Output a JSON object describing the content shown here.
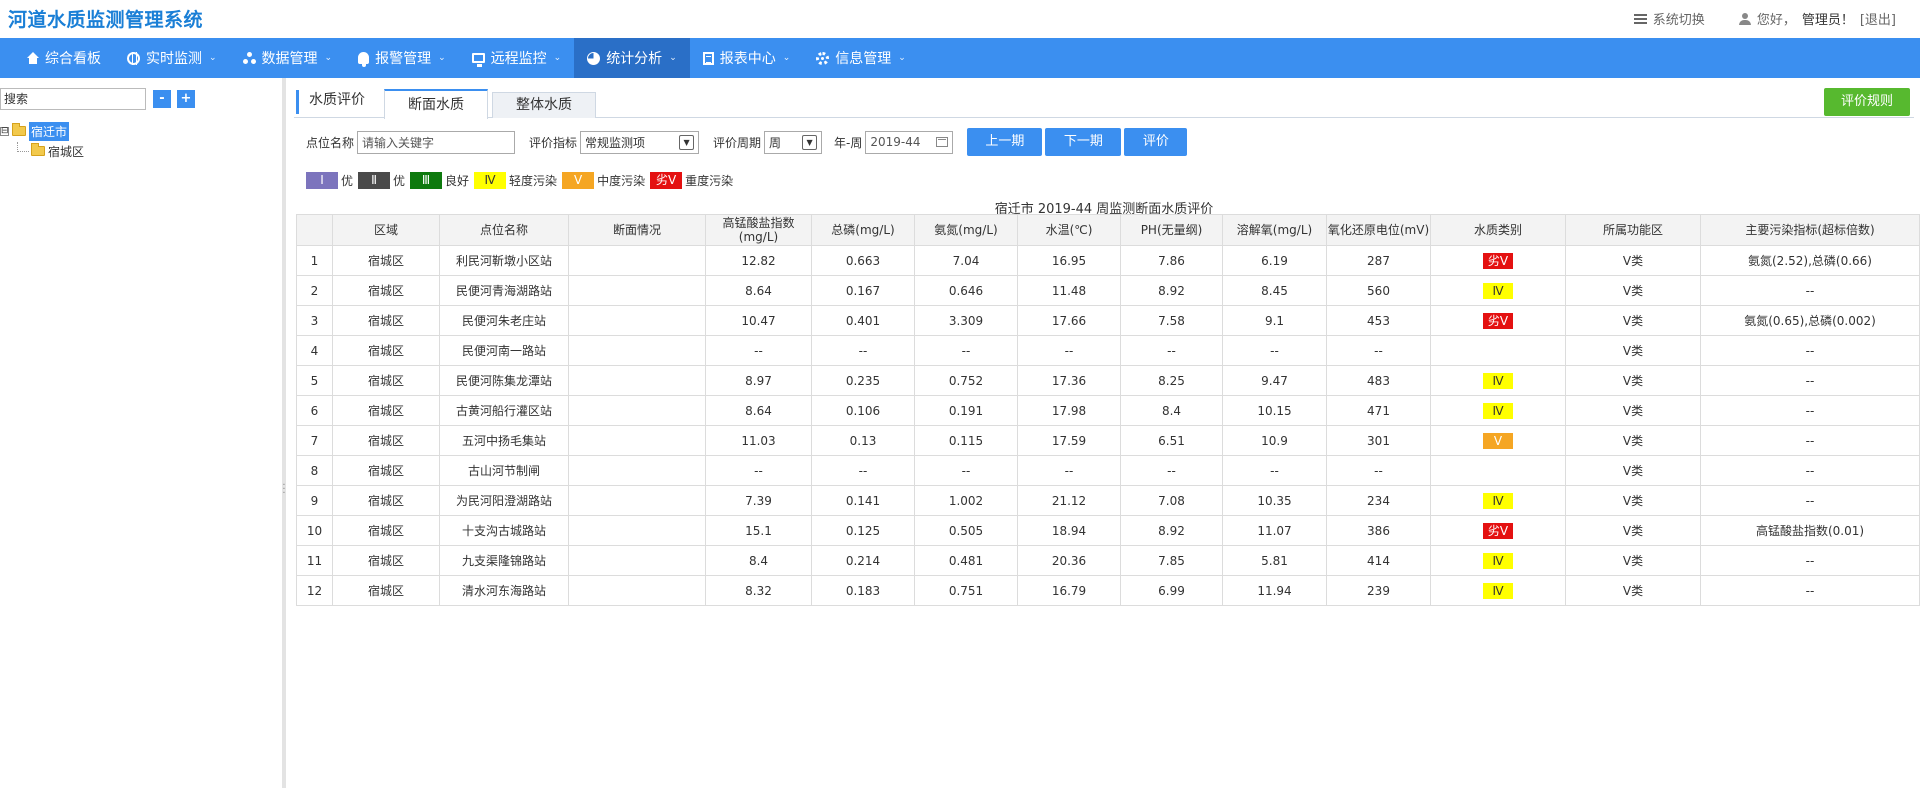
{
  "app": {
    "title": "河道水质监测管理系统"
  },
  "topbar": {
    "system_switch": "系统切换",
    "greeting": "您好，",
    "username": "管理员！",
    "logout": "[退出]"
  },
  "nav": {
    "items": [
      {
        "label": "综合看板",
        "icon": "home-icon",
        "caret": ""
      },
      {
        "label": "实时监测",
        "icon": "globe-icon",
        "caret": "⌄"
      },
      {
        "label": "数据管理",
        "icon": "network-icon",
        "caret": "⌄"
      },
      {
        "label": "报警管理",
        "icon": "bell-icon",
        "caret": "⌄"
      },
      {
        "label": "远程监控",
        "icon": "monitor-icon",
        "caret": "⌄"
      },
      {
        "label": "统计分析",
        "icon": "pie-chart-icon",
        "caret": "⌄"
      },
      {
        "label": "报表中心",
        "icon": "report-icon",
        "caret": "⌄"
      },
      {
        "label": "信息管理",
        "icon": "gear-icon",
        "caret": "⌄"
      }
    ],
    "active_index": 5
  },
  "sidebar": {
    "search_value": "搜索",
    "minus": "-",
    "plus": "+",
    "tree_toggle": "⊟",
    "tree": {
      "root": "宿迁市",
      "child": "宿城区"
    }
  },
  "tabs": {
    "lead": "水质评价",
    "items": [
      "断面水质",
      "整体水质"
    ],
    "rule_button": "评价规则"
  },
  "filters": {
    "site_label": "点位名称",
    "site_placeholder": "请输入关键字",
    "index_label": "评价指标",
    "index_value": "常规监测项",
    "period_label": "评价周期",
    "period_value": "周",
    "year_week_label": "年-周",
    "year_week_value": "2019-44",
    "prev_button": "上一期",
    "next_button": "下一期",
    "eval_button": "评价"
  },
  "legend": [
    {
      "code": "Ⅰ",
      "text": "优",
      "bg": "#7c74bd",
      "fg": "#ffffff"
    },
    {
      "code": "Ⅱ",
      "text": "优",
      "bg": "#4a4a4a",
      "fg": "#ffffff"
    },
    {
      "code": "Ⅲ",
      "text": "良好",
      "bg": "#0e7a0e",
      "fg": "#ffffff"
    },
    {
      "code": "Ⅳ",
      "text": "轻度污染",
      "bg": "#ffff00",
      "fg": "#333333"
    },
    {
      "code": "Ⅴ",
      "text": "中度污染",
      "bg": "#f5a623",
      "fg": "#ffffff"
    },
    {
      "code": "劣Ⅴ",
      "text": "重度污染",
      "bg": "#e41111",
      "fg": "#ffffff"
    }
  ],
  "table": {
    "title": "宿迁市 2019-44 周监测断面水质评价",
    "headers": [
      "",
      "区域",
      "点位名称",
      "断面情况",
      "高锰酸盐指数(mg/L)",
      "总磷(mg/L)",
      "氨氮(mg/L)",
      "水温(℃)",
      "PH(无量纲)",
      "溶解氧(mg/L)",
      "氧化还原电位(mV)",
      "水质类别",
      "所属功能区",
      "主要污染指标(超标倍数)"
    ],
    "rows": [
      [
        "1",
        "宿城区",
        "利民河靳墩小区站",
        "",
        "12.82",
        "0.663",
        "7.04",
        "16.95",
        "7.86",
        "6.19",
        "287",
        "劣Ⅴ",
        "Ⅴ类",
        "氨氮(2.52),总磷(0.66)"
      ],
      [
        "2",
        "宿城区",
        "民便河青海湖路站",
        "",
        "8.64",
        "0.167",
        "0.646",
        "11.48",
        "8.92",
        "8.45",
        "560",
        "Ⅳ",
        "Ⅴ类",
        "--"
      ],
      [
        "3",
        "宿城区",
        "民便河朱老庄站",
        "",
        "10.47",
        "0.401",
        "3.309",
        "17.66",
        "7.58",
        "9.1",
        "453",
        "劣Ⅴ",
        "Ⅴ类",
        "氨氮(0.65),总磷(0.002)"
      ],
      [
        "4",
        "宿城区",
        "民便河南一路站",
        "",
        "--",
        "--",
        "--",
        "--",
        "--",
        "--",
        "--",
        "",
        "Ⅴ类",
        "--"
      ],
      [
        "5",
        "宿城区",
        "民便河陈集龙潭站",
        "",
        "8.97",
        "0.235",
        "0.752",
        "17.36",
        "8.25",
        "9.47",
        "483",
        "Ⅳ",
        "Ⅴ类",
        "--"
      ],
      [
        "6",
        "宿城区",
        "古黄河船行灌区站",
        "",
        "8.64",
        "0.106",
        "0.191",
        "17.98",
        "8.4",
        "10.15",
        "471",
        "Ⅳ",
        "Ⅴ类",
        "--"
      ],
      [
        "7",
        "宿城区",
        "五河中扬毛集站",
        "",
        "11.03",
        "0.13",
        "0.115",
        "17.59",
        "6.51",
        "10.9",
        "301",
        "Ⅴ",
        "Ⅴ类",
        "--"
      ],
      [
        "8",
        "宿城区",
        "古山河节制闸",
        "",
        "--",
        "--",
        "--",
        "--",
        "--",
        "--",
        "--",
        "",
        "Ⅴ类",
        "--"
      ],
      [
        "9",
        "宿城区",
        "为民河阳澄湖路站",
        "",
        "7.39",
        "0.141",
        "1.002",
        "21.12",
        "7.08",
        "10.35",
        "234",
        "Ⅳ",
        "Ⅴ类",
        "--"
      ],
      [
        "10",
        "宿城区",
        "十支沟古城路站",
        "",
        "15.1",
        "0.125",
        "0.505",
        "18.94",
        "8.92",
        "11.07",
        "386",
        "劣Ⅴ",
        "Ⅴ类",
        "高锰酸盐指数(0.01)"
      ],
      [
        "11",
        "宿城区",
        "九支渠隆锦路站",
        "",
        "8.4",
        "0.214",
        "0.481",
        "20.36",
        "7.85",
        "5.81",
        "414",
        "Ⅳ",
        "Ⅴ类",
        "--"
      ],
      [
        "12",
        "宿城区",
        "清水河东海路站",
        "",
        "8.32",
        "0.183",
        "0.751",
        "16.79",
        "6.99",
        "11.94",
        "239",
        "Ⅳ",
        "Ⅴ类",
        "--"
      ]
    ]
  }
}
